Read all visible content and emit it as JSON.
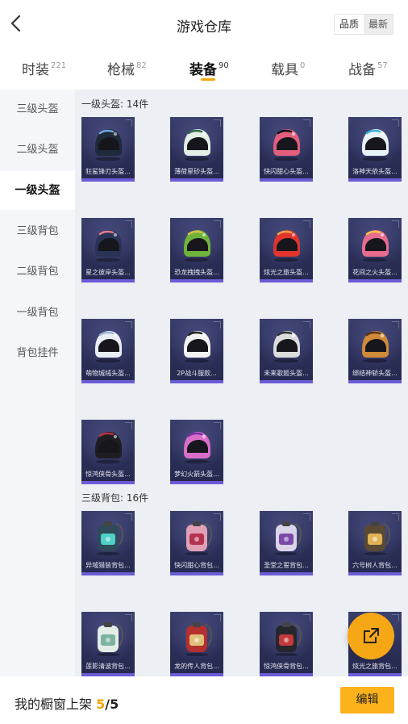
{
  "header": {
    "title": "游戏仓库",
    "sort_options": [
      "品质",
      "最新"
    ]
  },
  "tabs": [
    {
      "label": "时装",
      "count": "221",
      "active": false
    },
    {
      "label": "枪械",
      "count": "82",
      "active": false
    },
    {
      "label": "装备",
      "count": "90",
      "active": true
    },
    {
      "label": "载具",
      "count": "0",
      "active": false
    },
    {
      "label": "战备",
      "count": "57",
      "active": false
    }
  ],
  "sidebar": {
    "items": [
      {
        "label": "三级头盔",
        "active": false
      },
      {
        "label": "二级头盔",
        "active": false
      },
      {
        "label": "一级头盔",
        "active": true
      },
      {
        "label": "三级背包",
        "active": false
      },
      {
        "label": "二级背包",
        "active": false
      },
      {
        "label": "一级背包",
        "active": false
      },
      {
        "label": "背包挂件",
        "active": false
      }
    ]
  },
  "sections": [
    {
      "title": "一级头盔: 14件",
      "items": [
        {
          "name": "狂鲨锋刃头盔...",
          "icon": "helmet-icon",
          "color": "#1f2a3a",
          "accent": "#6fa6d9"
        },
        {
          "name": "薄荷星砂头盔...",
          "icon": "helmet-icon",
          "color": "#e3efe6",
          "accent": "#2f6b48"
        },
        {
          "name": "快闪甜心头盔...",
          "icon": "helmet-icon",
          "color": "#e35d7d",
          "accent": "#111111"
        },
        {
          "name": "洛神天依头盔...",
          "icon": "helmet-icon",
          "color": "#e8f2f7",
          "accent": "#37b4d9"
        },
        {
          "name": "星之彼岸头盔...",
          "icon": "helmet-icon",
          "color": "#2a3256",
          "accent": "#e27a8a"
        },
        {
          "name": "恐龙拽拽头盔...",
          "icon": "helmet-icon",
          "color": "#6fb33a",
          "accent": "#d9c04a"
        },
        {
          "name": "炫光之旅头盔...",
          "icon": "helmet-icon",
          "color": "#e0342c",
          "accent": "#f0a24a"
        },
        {
          "name": "花间之火头盔...",
          "icon": "helmet-icon",
          "color": "#e86c8e",
          "accent": "#f2c64a"
        },
        {
          "name": "萌物城绒头盔...",
          "icon": "helmet-icon",
          "color": "#e9eef5",
          "accent": "#9fb4d0"
        },
        {
          "name": "2P战斗服款...",
          "icon": "helmet-icon",
          "color": "#f2f2f2",
          "accent": "#222222"
        },
        {
          "name": "未来歌姬头盔...",
          "icon": "helmet-icon",
          "color": "#dcdcdc",
          "accent": "#333333"
        },
        {
          "name": "绑结神轿头盔...",
          "icon": "helmet-icon",
          "color": "#d08a3a",
          "accent": "#5a3516"
        },
        {
          "name": "惊鸿侠骨头盔...",
          "icon": "helmet-icon",
          "color": "#1e1e22",
          "accent": "#b83040"
        },
        {
          "name": "梦幻火箭头盔...",
          "icon": "helmet-icon",
          "color": "#d96ec9",
          "accent": "#7a2fa3"
        }
      ]
    },
    {
      "title": "三级背包: 16件",
      "items": [
        {
          "name": "异域猎装背包...",
          "icon": "backpack-icon",
          "color": "#2f4a58",
          "accent": "#4fd0c8"
        },
        {
          "name": "快闪甜心背包...",
          "icon": "backpack-icon",
          "color": "#e0a0b5",
          "accent": "#b4324e"
        },
        {
          "name": "圣堂之誓背包...",
          "icon": "backpack-icon",
          "color": "#d9d4e8",
          "accent": "#7b4aa8"
        },
        {
          "name": "六号树人背包...",
          "icon": "backpack-icon",
          "color": "#5a4a34",
          "accent": "#e0b255"
        },
        {
          "name": "莲影清波背包...",
          "icon": "backpack-icon",
          "color": "#e4ece6",
          "accent": "#7ab3a0"
        },
        {
          "name": "龙的传人背包...",
          "icon": "backpack-icon",
          "color": "#b3302e",
          "accent": "#e0c07a"
        },
        {
          "name": "惊鸿侠骨背包...",
          "icon": "backpack-icon",
          "color": "#26262d",
          "accent": "#c23a3a"
        },
        {
          "name": "炫光之旅背包...",
          "icon": "backpack-icon",
          "color": "#3a6fd0",
          "accent": "#f0a24a"
        }
      ]
    }
  ],
  "bottom_bar": {
    "shelf_label": "我的橱窗上架",
    "shelf_current": "5",
    "shelf_total": "5",
    "edit_label": "编辑"
  },
  "accent_color": "#f5a800"
}
